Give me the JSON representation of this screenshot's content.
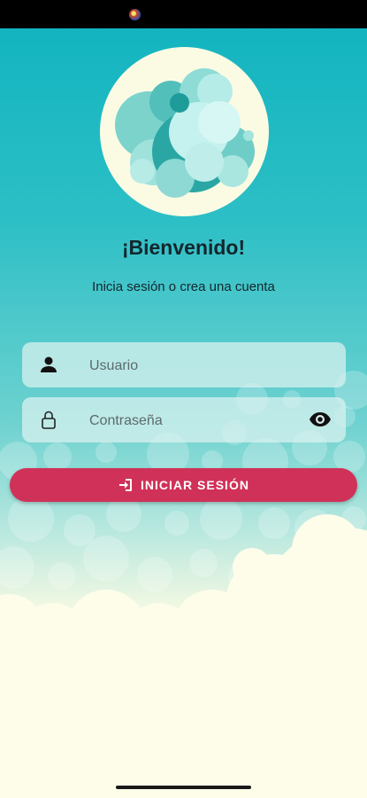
{
  "header": {
    "title": "¡Bienvenido!",
    "subtitle": "Inicia sesión o crea una cuenta"
  },
  "form": {
    "username": {
      "placeholder": "Usuario",
      "value": "",
      "icon": "person-icon"
    },
    "password": {
      "placeholder": "Contraseña",
      "value": "",
      "icon": "lock-icon",
      "toggle_icon": "eye-icon"
    },
    "login_button": {
      "label": "INICIAR SESIÓN",
      "icon": "login-icon"
    }
  },
  "colors": {
    "accent": "#d03158",
    "teal_top": "#0fb3bf",
    "cream": "#fdfde9",
    "text_dark": "#14262e"
  }
}
